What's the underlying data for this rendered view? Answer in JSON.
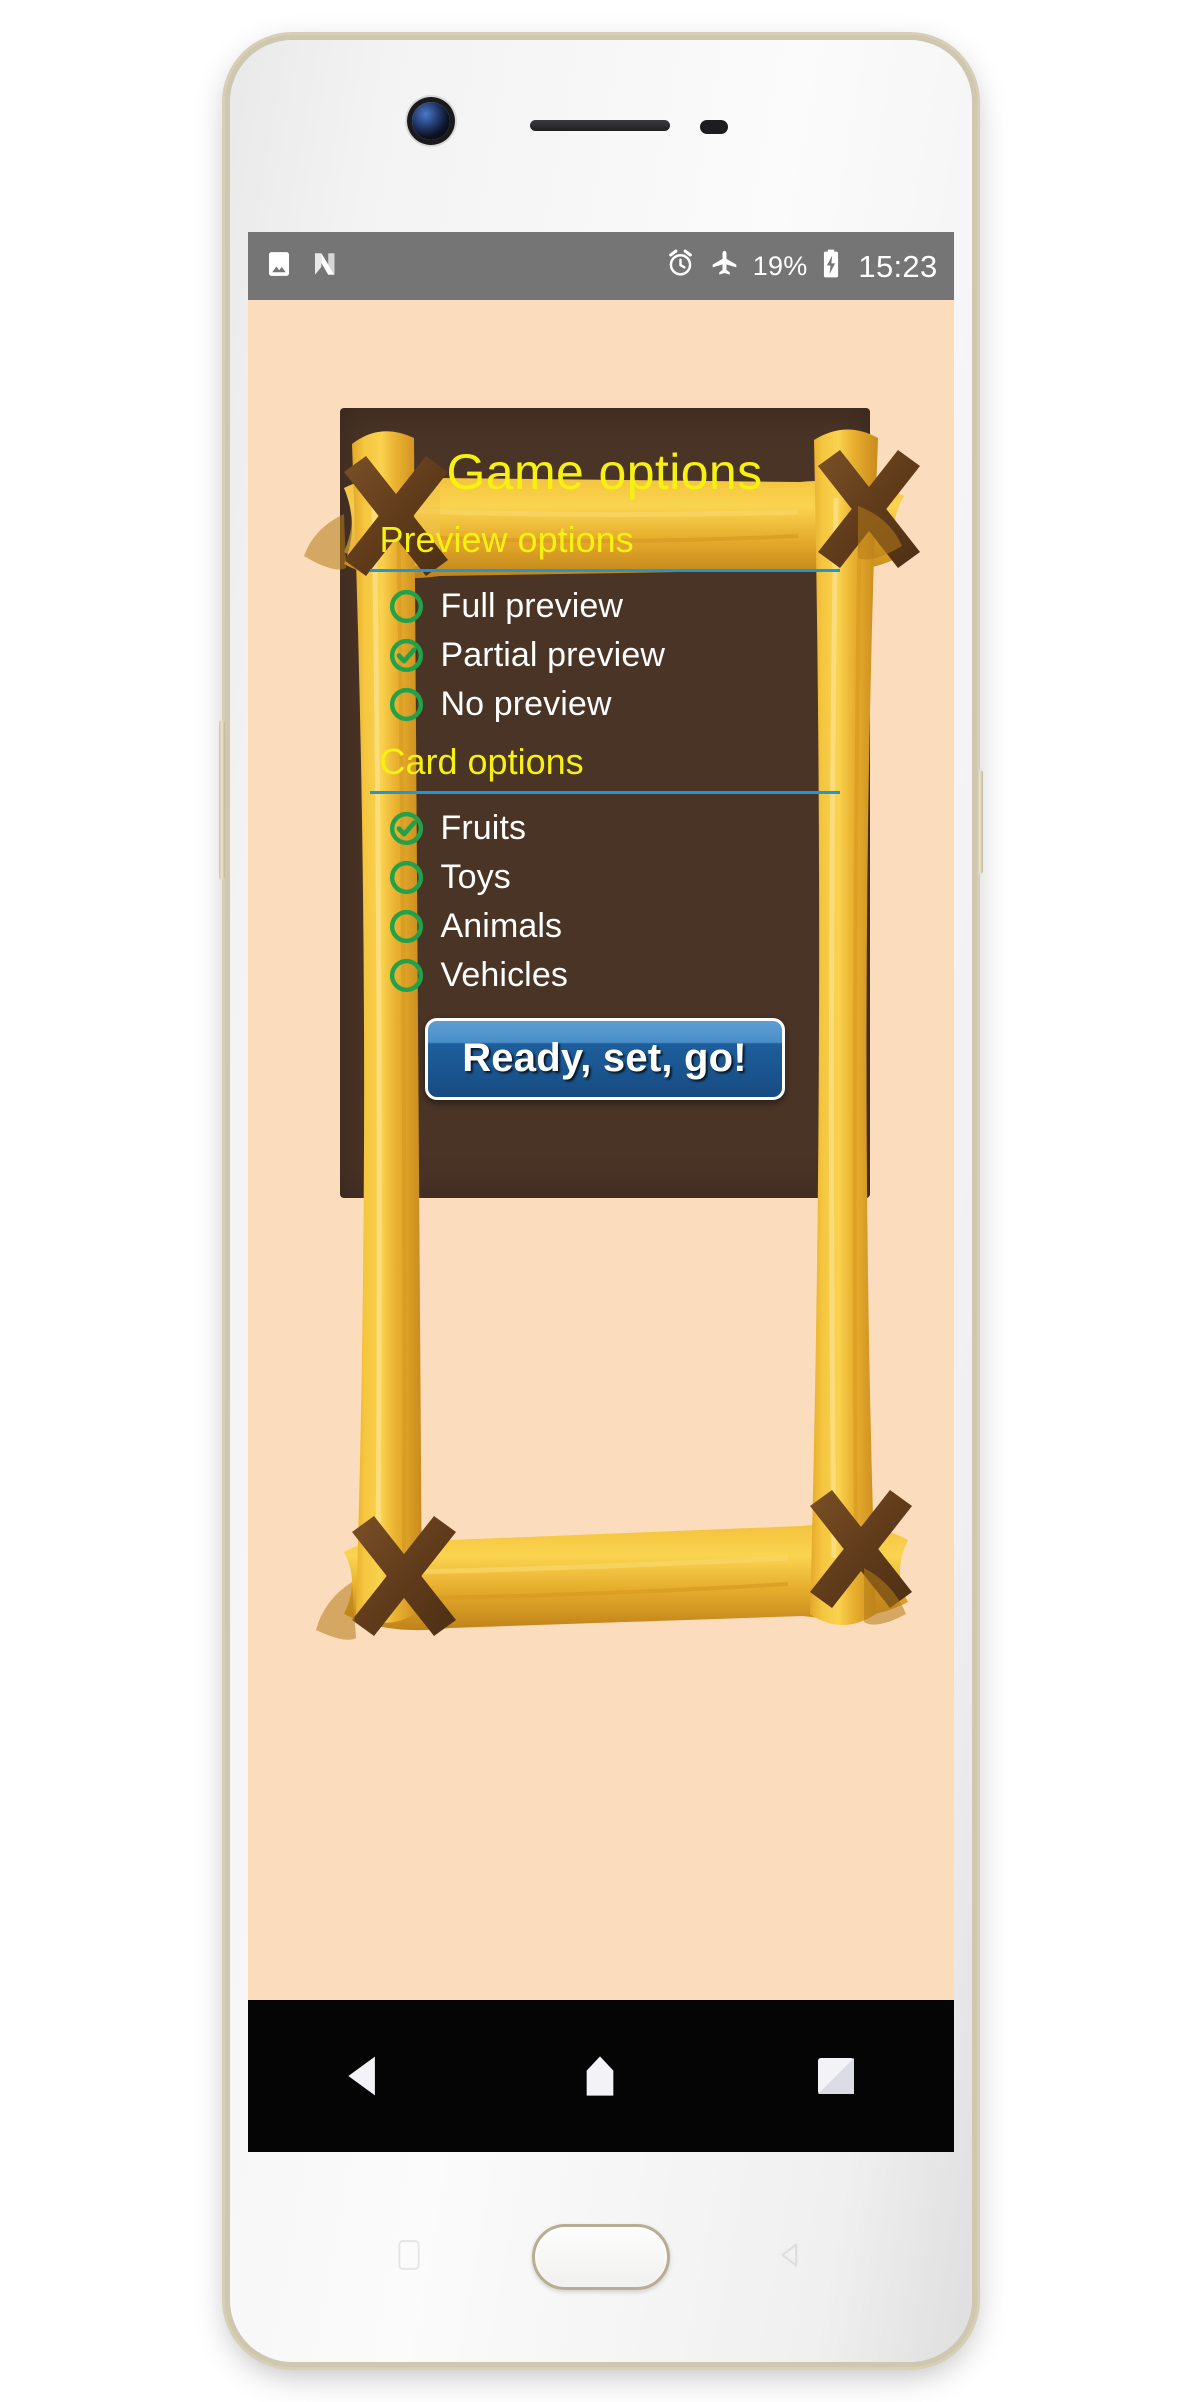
{
  "device": {
    "name": "android-phone",
    "frame_color": "#d7cfb5"
  },
  "status_bar": {
    "background": "#757575",
    "left_icons": [
      {
        "name": "image-icon",
        "label": "Screenshot"
      },
      {
        "name": "android-n-icon",
        "label": "N"
      }
    ],
    "right_icons": [
      {
        "name": "alarm-clock-icon",
        "label": "Alarm"
      },
      {
        "name": "airplane-mode-icon",
        "label": "Airplane mode"
      },
      {
        "name": "battery-charging-icon",
        "label": "Battery charging"
      }
    ],
    "battery_percent": "19%",
    "time": "15:23"
  },
  "app": {
    "background": "#fbdcbd",
    "board_color": "#4a3426",
    "accent_yellow": "#f7f112",
    "accent_blue": "#2196d4",
    "accent_green": "#21a24a",
    "title": "Game options",
    "sections": [
      {
        "name": "preview-options",
        "label": "Preview options",
        "options": [
          {
            "label": "Full preview",
            "selected": false
          },
          {
            "label": "Partial preview",
            "selected": true
          },
          {
            "label": "No preview",
            "selected": false
          }
        ]
      },
      {
        "name": "card-options",
        "label": "Card options",
        "options": [
          {
            "label": "Fruits",
            "selected": true
          },
          {
            "label": "Toys",
            "selected": false
          },
          {
            "label": "Animals",
            "selected": false
          },
          {
            "label": "Vehicles",
            "selected": false
          }
        ]
      }
    ],
    "play_button": {
      "label": "Ready, set, go!",
      "color_top": "#5d9ed2",
      "color_bottom": "#174b80"
    }
  },
  "nav_bar": {
    "background": "#050505",
    "items": [
      {
        "name": "back-button",
        "label": "Back"
      },
      {
        "name": "home-button",
        "label": "Home"
      },
      {
        "name": "recents-button",
        "label": "Recents"
      }
    ]
  }
}
